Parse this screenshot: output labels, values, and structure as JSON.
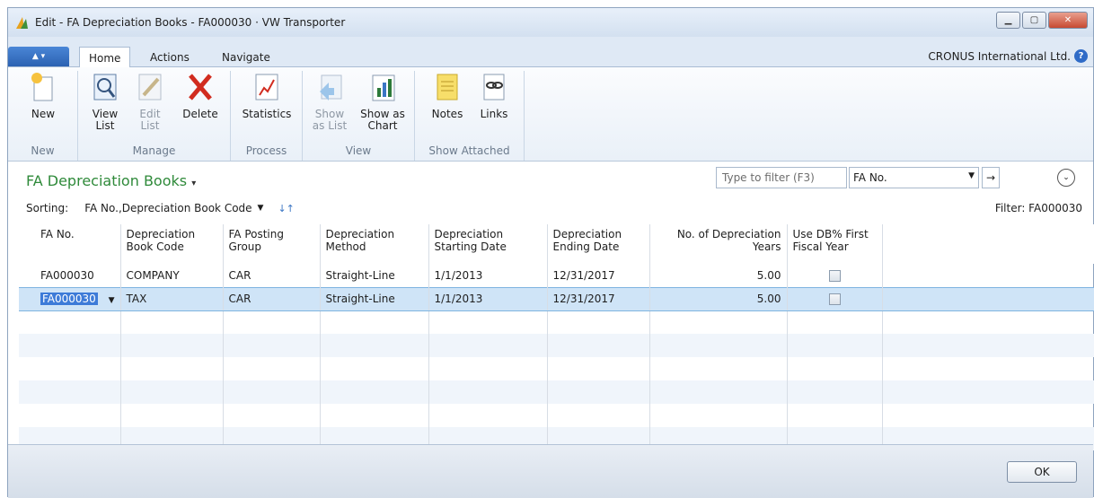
{
  "window": {
    "title": "Edit - FA Depreciation Books - FA000030 · VW Transporter",
    "controls": [
      "minimize-icon",
      "maximize-icon",
      "close-icon"
    ]
  },
  "tabs": [
    {
      "label": "Home",
      "active": true
    },
    {
      "label": "Actions"
    },
    {
      "label": "Navigate"
    }
  ],
  "company": "CRONUS International Ltd.",
  "ribbon": {
    "groups": [
      {
        "label": "New",
        "buttons": [
          {
            "label": "New",
            "icon": "new-icon"
          }
        ]
      },
      {
        "label": "Manage",
        "buttons": [
          {
            "label": "View\nList",
            "icon": "view-list-icon"
          },
          {
            "label": "Edit\nList",
            "icon": "edit-list-icon",
            "disabled": true
          },
          {
            "label": "Delete",
            "icon": "delete-icon"
          }
        ]
      },
      {
        "label": "Process",
        "buttons": [
          {
            "label": "Statistics",
            "icon": "statistics-icon"
          }
        ]
      },
      {
        "label": "View",
        "buttons": [
          {
            "label": "Show\nas List",
            "icon": "show-as-list-icon",
            "disabled": true
          },
          {
            "label": "Show as\nChart",
            "icon": "show-as-chart-icon"
          }
        ]
      },
      {
        "label": "Show Attached",
        "buttons": [
          {
            "label": "Notes",
            "icon": "notes-icon"
          },
          {
            "label": "Links",
            "icon": "links-icon"
          }
        ]
      }
    ]
  },
  "page": {
    "title": "FA Depreciation Books",
    "filter_placeholder": "Type to filter (F3)",
    "filter_field": "FA No.",
    "sorting_label": "Sorting:",
    "sorting_value": "FA No.,Depreciation Book Code",
    "filter_status": "Filter: FA000030"
  },
  "table": {
    "columns": [
      "FA No.",
      "Depreciation Book Code",
      "FA Posting Group",
      "Depreciation Method",
      "Depreciation Starting Date",
      "Depreciation Ending Date",
      "No. of Depreciation Years",
      "Use DB% First Fiscal Year"
    ],
    "rows": [
      [
        "FA000030",
        "COMPANY",
        "CAR",
        "Straight-Line",
        "1/1/2013",
        "12/31/2017",
        "5.00",
        false
      ],
      [
        "FA000030",
        "TAX",
        "CAR",
        "Straight-Line",
        "1/1/2013",
        "12/31/2017",
        "5.00",
        false
      ]
    ]
  },
  "footer": {
    "ok_label": "OK"
  }
}
